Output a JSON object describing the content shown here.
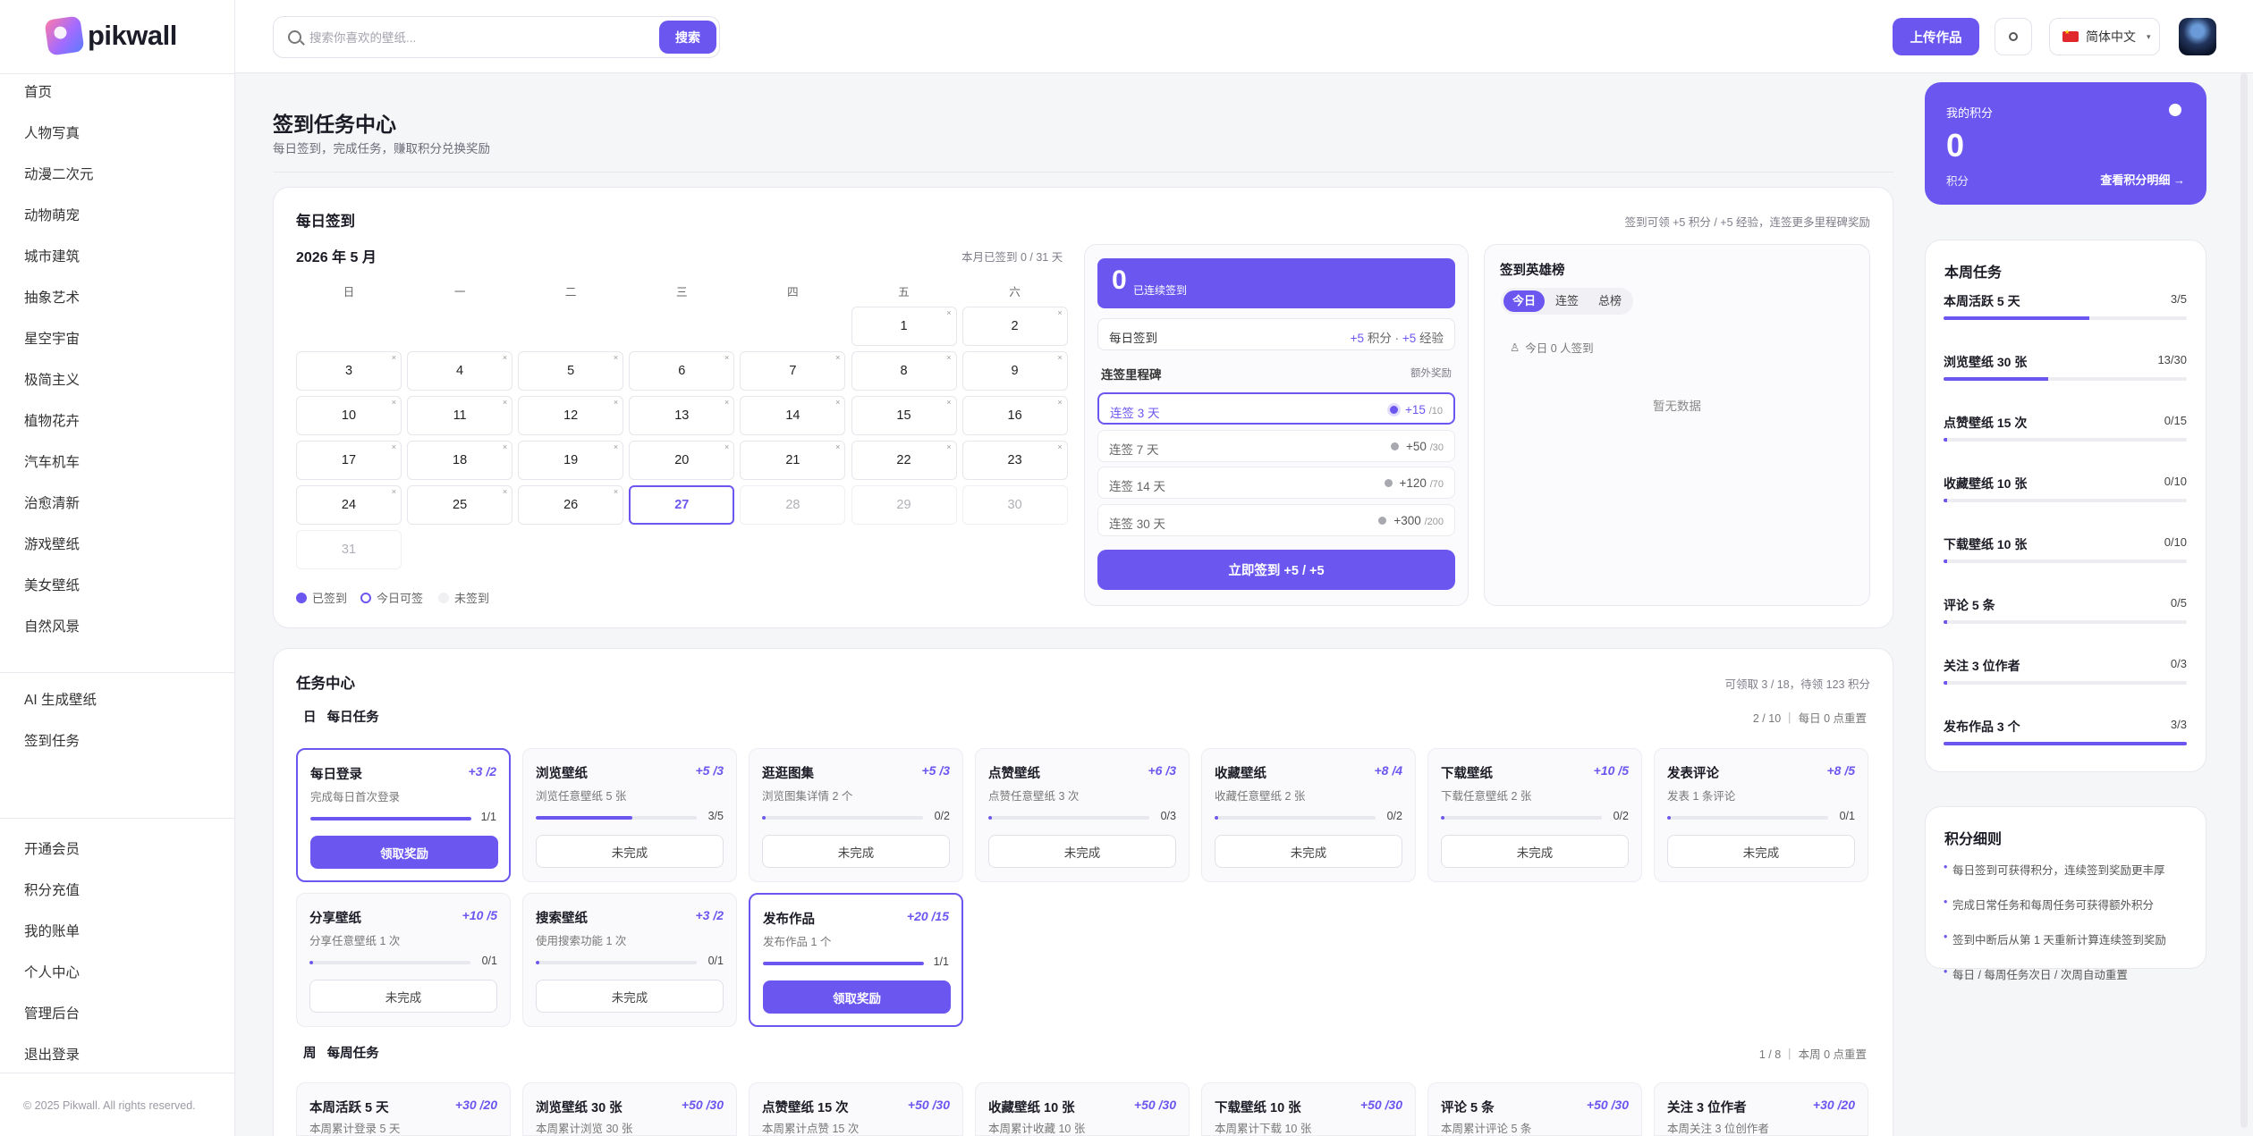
{
  "app": {
    "logo": "pikwall",
    "copyright": "© 2025 Pikwall. All rights reserved."
  },
  "nav": {
    "categories": [
      "首页",
      "人物写真",
      "动漫二次元",
      "动物萌宠",
      "城市建筑",
      "抽象艺术",
      "星空宇宙",
      "极简主义",
      "植物花卉",
      "汽车机车",
      "治愈清新",
      "游戏壁纸",
      "美女壁纸",
      "自然风景"
    ],
    "tools": [
      "AI 生成壁纸",
      "签到任务"
    ],
    "account": [
      "开通会员",
      "积分充值",
      "我的账单",
      "个人中心",
      "管理后台",
      "退出登录"
    ]
  },
  "topbar": {
    "search_placeholder": "搜索你喜欢的壁纸...",
    "search_button": "搜索",
    "upload": "上传作品",
    "language": "简体中文"
  },
  "page": {
    "title": "签到任务中心",
    "subtitle": "每日签到，完成任务，赚取积分兑换奖励"
  },
  "checkin": {
    "title": "每日签到",
    "rule_hint": "签到可领 +5 积分 / +5 经验，连签更多里程碑奖励",
    "month": "2026 年 5 月",
    "month_summary": "本月已签到 0 / 31 天",
    "weekdays": [
      "日",
      "一",
      "二",
      "三",
      "四",
      "五",
      "六"
    ],
    "days": [
      {
        "d": "1",
        "s": "missed"
      },
      {
        "d": "2",
        "s": "missed"
      },
      {
        "d": "3",
        "s": "missed"
      },
      {
        "d": "4",
        "s": "missed"
      },
      {
        "d": "5",
        "s": "missed"
      },
      {
        "d": "6",
        "s": "missed"
      },
      {
        "d": "7",
        "s": "missed"
      },
      {
        "d": "8",
        "s": "missed"
      },
      {
        "d": "9",
        "s": "missed"
      },
      {
        "d": "10",
        "s": "missed"
      },
      {
        "d": "11",
        "s": "missed"
      },
      {
        "d": "12",
        "s": "missed"
      },
      {
        "d": "13",
        "s": "missed"
      },
      {
        "d": "14",
        "s": "missed"
      },
      {
        "d": "15",
        "s": "missed"
      },
      {
        "d": "16",
        "s": "missed"
      },
      {
        "d": "17",
        "s": "missed"
      },
      {
        "d": "18",
        "s": "missed"
      },
      {
        "d": "19",
        "s": "missed"
      },
      {
        "d": "20",
        "s": "missed"
      },
      {
        "d": "21",
        "s": "missed"
      },
      {
        "d": "22",
        "s": "missed"
      },
      {
        "d": "23",
        "s": "missed"
      },
      {
        "d": "24",
        "s": "missed"
      },
      {
        "d": "25",
        "s": "missed"
      },
      {
        "d": "26",
        "s": "missed"
      },
      {
        "d": "27",
        "s": "today"
      },
      {
        "d": "28",
        "s": "future"
      },
      {
        "d": "29",
        "s": "future"
      },
      {
        "d": "30",
        "s": "future"
      },
      {
        "d": "31",
        "s": "future"
      }
    ],
    "first_weekday": 5,
    "legend": [
      "已签到",
      "今日可签",
      "未签到"
    ],
    "streak_count": "0",
    "streak_label": "已连续签到",
    "daily_label": "每日签到",
    "daily_points": "+5",
    "daily_points_unit": "积分",
    "daily_exp": "+5",
    "daily_exp_unit": "经验",
    "milestone_title": "连签里程碑",
    "milestone_extra": "额外奖励",
    "milestones": [
      {
        "label": "连签 3 天",
        "pts": "+15",
        "sub": "/10",
        "active": true
      },
      {
        "label": "连签 7 天",
        "pts": "+50",
        "sub": "/30",
        "active": false
      },
      {
        "label": "连签 14 天",
        "pts": "+120",
        "sub": "/70",
        "active": false
      },
      {
        "label": "连签 30 天",
        "pts": "+300",
        "sub": "/200",
        "active": false
      }
    ],
    "checkin_button": "立即签到 +5 / +5",
    "leaderboard_title": "签到英雄榜",
    "leaderboard_tabs": [
      "今日",
      "连签",
      "总榜"
    ],
    "leaderboard_count": "今日 0 人签到",
    "leaderboard_empty": "暂无数据"
  },
  "tasks": {
    "title": "任务中心",
    "summary": "可领取 3 / 18，待领 123 积分",
    "daily_icon": "日",
    "daily_label": "每日任务",
    "daily_summary": "2 / 10 ｜ 每日 0 点重置",
    "daily": [
      {
        "name": "每日登录",
        "pts": "+3 /2",
        "desc": "完成每日首次登录",
        "prog": "1/1",
        "ratio": 1,
        "done": true,
        "btn": "领取奖励"
      },
      {
        "name": "浏览壁纸",
        "pts": "+5 /3",
        "desc": "浏览任意壁纸 5 张",
        "prog": "3/5",
        "ratio": 0.6,
        "done": false,
        "btn": "未完成"
      },
      {
        "name": "逛逛图集",
        "pts": "+5 /3",
        "desc": "浏览图集详情 2 个",
        "prog": "0/2",
        "ratio": 0,
        "done": false,
        "btn": "未完成"
      },
      {
        "name": "点赞壁纸",
        "pts": "+6 /3",
        "desc": "点赞任意壁纸 3 次",
        "prog": "0/3",
        "ratio": 0,
        "done": false,
        "btn": "未完成"
      },
      {
        "name": "收藏壁纸",
        "pts": "+8 /4",
        "desc": "收藏任意壁纸 2 张",
        "prog": "0/2",
        "ratio": 0,
        "done": false,
        "btn": "未完成"
      },
      {
        "name": "下载壁纸",
        "pts": "+10 /5",
        "desc": "下载任意壁纸 2 张",
        "prog": "0/2",
        "ratio": 0,
        "done": false,
        "btn": "未完成"
      },
      {
        "name": "发表评论",
        "pts": "+8 /5",
        "desc": "发表 1 条评论",
        "prog": "0/1",
        "ratio": 0,
        "done": false,
        "btn": "未完成"
      },
      {
        "name": "分享壁纸",
        "pts": "+10 /5",
        "desc": "分享任意壁纸 1 次",
        "prog": "0/1",
        "ratio": 0,
        "done": false,
        "btn": "未完成"
      },
      {
        "name": "搜索壁纸",
        "pts": "+3 /2",
        "desc": "使用搜索功能 1 次",
        "prog": "0/1",
        "ratio": 0,
        "done": false,
        "btn": "未完成"
      },
      {
        "name": "发布作品",
        "pts": "+20 /15",
        "desc": "发布作品 1 个",
        "prog": "1/1",
        "ratio": 1,
        "done": true,
        "btn": "领取奖励"
      }
    ],
    "weekly_icon": "周",
    "weekly_label": "每周任务",
    "weekly_summary": "1 / 8 ｜ 本周 0 点重置",
    "weekly": [
      {
        "name": "本周活跃 5 天",
        "pts": "+30 /20",
        "desc": "本周累计登录 5 天"
      },
      {
        "name": "浏览壁纸 30 张",
        "pts": "+50 /30",
        "desc": "本周累计浏览 30 张"
      },
      {
        "name": "点赞壁纸 15 次",
        "pts": "+50 /30",
        "desc": "本周累计点赞 15 次"
      },
      {
        "name": "收藏壁纸 10 张",
        "pts": "+50 /30",
        "desc": "本周累计收藏 10 张"
      },
      {
        "name": "下载壁纸 10 张",
        "pts": "+50 /30",
        "desc": "本周累计下载 10 张"
      },
      {
        "name": "评论 5 条",
        "pts": "+50 /30",
        "desc": "本周累计评论 5 条"
      },
      {
        "name": "关注 3 位作者",
        "pts": "+30 /20",
        "desc": "本周关注 3 位创作者"
      }
    ]
  },
  "points": {
    "label": "我的积分",
    "value": "0",
    "unit": "积分",
    "link": "查看积分明细 →"
  },
  "weekly_panel": {
    "title": "本周任务",
    "items": [
      {
        "name": "本周活跃 5 天",
        "count": "3/5",
        "ratio": 0.6
      },
      {
        "name": "浏览壁纸 30 张",
        "count": "13/30",
        "ratio": 0.43
      },
      {
        "name": "点赞壁纸 15 次",
        "count": "0/15",
        "ratio": 0
      },
      {
        "name": "收藏壁纸 10 张",
        "count": "0/10",
        "ratio": 0
      },
      {
        "name": "下载壁纸 10 张",
        "count": "0/10",
        "ratio": 0
      },
      {
        "name": "评论 5 条",
        "count": "0/5",
        "ratio": 0
      },
      {
        "name": "关注 3 位作者",
        "count": "0/3",
        "ratio": 0
      },
      {
        "name": "发布作品 3 个",
        "count": "3/3",
        "ratio": 1
      }
    ]
  },
  "rules": {
    "title": "积分细则",
    "items": [
      "每日签到可获得积分，连续签到奖励更丰厚",
      "完成日常任务和每周任务可获得额外积分",
      "签到中断后从第 1 天重新计算连续签到奖励",
      "每日 / 每周任务次日 / 次周自动重置"
    ]
  },
  "colors": {
    "accent": "#6b57f0"
  }
}
